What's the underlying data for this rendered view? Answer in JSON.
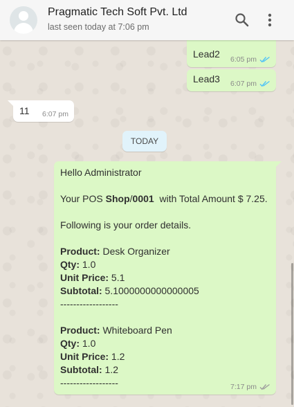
{
  "header": {
    "title": "Pragmatic Tech Soft Pvt. Ltd",
    "status": "last seen today at 7:06 pm",
    "icons": {
      "search": "search-icon",
      "menu": "more-vert-icon"
    }
  },
  "messages": [
    {
      "text": "Lead2",
      "time": "6:05 pm",
      "direction": "out",
      "status": "read"
    },
    {
      "text": "Lead3",
      "time": "6:07 pm",
      "direction": "out",
      "status": "read"
    },
    {
      "text": "11",
      "time": "6:07 pm",
      "direction": "in"
    }
  ],
  "day_separator": "TODAY",
  "order_message": {
    "greeting": "Hello Administrator",
    "pos_prefix": "Your POS ",
    "pos_shop": "Shop",
    "pos_slash": "/",
    "pos_number": "0001",
    "pos_suffix": "  with Total Amount $ 7.25.",
    "following": "Following is your order details.",
    "items": [
      {
        "product_label": "Product:",
        "product": " Desk Organizer",
        "qty_label": "Qty:",
        "qty": " 1.0",
        "price_label": "Unit Price:",
        "price": " 5.1",
        "subtotal_label": "Subtotal:",
        "subtotal": " 5.1000000000000005",
        "divider": "------------------"
      },
      {
        "product_label": "Product:",
        "product": " Whiteboard Pen",
        "qty_label": "Qty:",
        "qty": " 1.0",
        "price_label": "Unit Price:",
        "price": " 1.2",
        "subtotal_label": "Subtotal:",
        "subtotal": " 1.2",
        "divider": "------------------"
      }
    ],
    "time": "7:17 pm",
    "status": "read"
  },
  "colors": {
    "outgoing_bubble": "#dcf8c6",
    "incoming_bubble": "#ffffff",
    "read_ticks": "#4fc3f7",
    "header_bg": "#f6f6f6"
  }
}
